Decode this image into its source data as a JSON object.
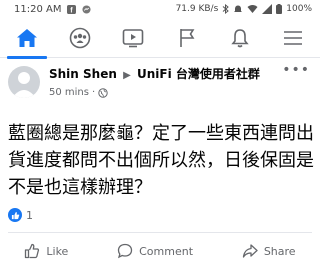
{
  "status_bar": {
    "time": "11:20 AM",
    "network_speed": "71.9 KB/s",
    "battery": "100%"
  },
  "tabs": [
    {
      "name": "home",
      "icon": "home-icon",
      "active": true
    },
    {
      "name": "groups",
      "icon": "groups-icon",
      "active": false
    },
    {
      "name": "watch",
      "icon": "video-icon",
      "active": false
    },
    {
      "name": "pages",
      "icon": "flag-icon",
      "active": false
    },
    {
      "name": "notifications",
      "icon": "bell-icon",
      "active": false
    },
    {
      "name": "menu",
      "icon": "menu-icon",
      "active": false
    }
  ],
  "post": {
    "author": "Shin Shen",
    "separator": "▶",
    "group": "UniFi 台灣使用者社群",
    "time": "50 mins",
    "dot": "·",
    "more": "•••",
    "body": "藍圈總是那麼龜？定了一些東西連問出貨進度都問不出個所以然，日後保固是不是也這樣辦理？",
    "reaction_count": "1"
  },
  "actions": {
    "like": "Like",
    "comment": "Comment",
    "share": "Share"
  },
  "colors": {
    "accent": "#1877f2",
    "text": "#050505",
    "muted": "#65676b"
  }
}
